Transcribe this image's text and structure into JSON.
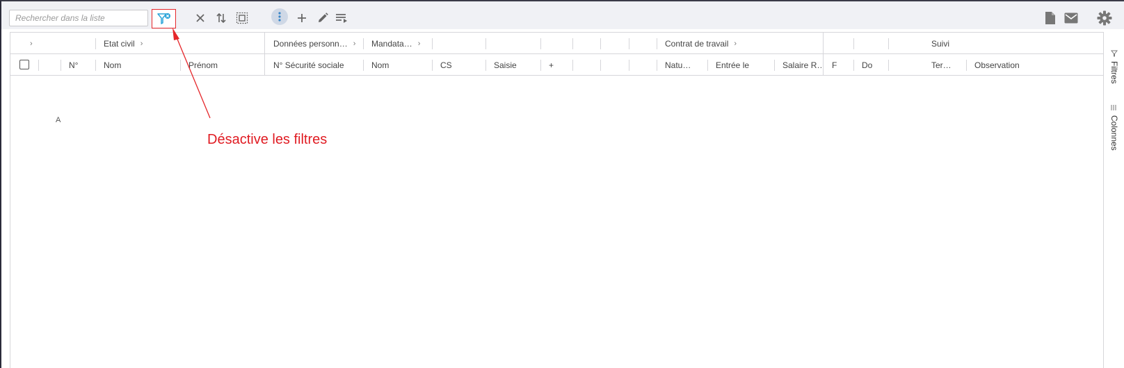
{
  "toolbar": {
    "search_placeholder": "Rechercher dans la liste",
    "icons": [
      "filter-off-icon",
      "clear-icon",
      "sort-icon",
      "select-all-icon",
      "more-vert-icon",
      "add-icon",
      "edit-icon",
      "list-action-icon",
      "document-icon",
      "mail-icon",
      "settings-icon"
    ]
  },
  "grid": {
    "groups": [
      {
        "label": "",
        "chevron": "›"
      },
      {
        "label": "Etat civil",
        "chevron": "›"
      },
      {
        "label": "Données personn…",
        "chevron": "›"
      },
      {
        "label": "Mandata…",
        "chevron": "›"
      },
      {
        "label": "Contrat de travail",
        "chevron": "›"
      },
      {
        "label": "Suivi"
      }
    ],
    "columns": [
      "N°",
      "Nom",
      "Prénom",
      "N° Sécurité sociale",
      "Nom",
      "CS",
      "Saisie",
      "+",
      "Natu…",
      "Entrée le",
      "Salaire R…",
      "F",
      "Do",
      "Ter…",
      "Observation"
    ],
    "row_fragment": "A"
  },
  "side_panel": {
    "filters_label": "Filtres",
    "columns_label": "Colonnes"
  },
  "annotation": {
    "text": "Désactive les filtres",
    "color": "#e01b22"
  },
  "colors": {
    "accent": "#29a3d8",
    "toolbar_bg": "#f0f1f5",
    "annotation_red": "#e5262a"
  }
}
